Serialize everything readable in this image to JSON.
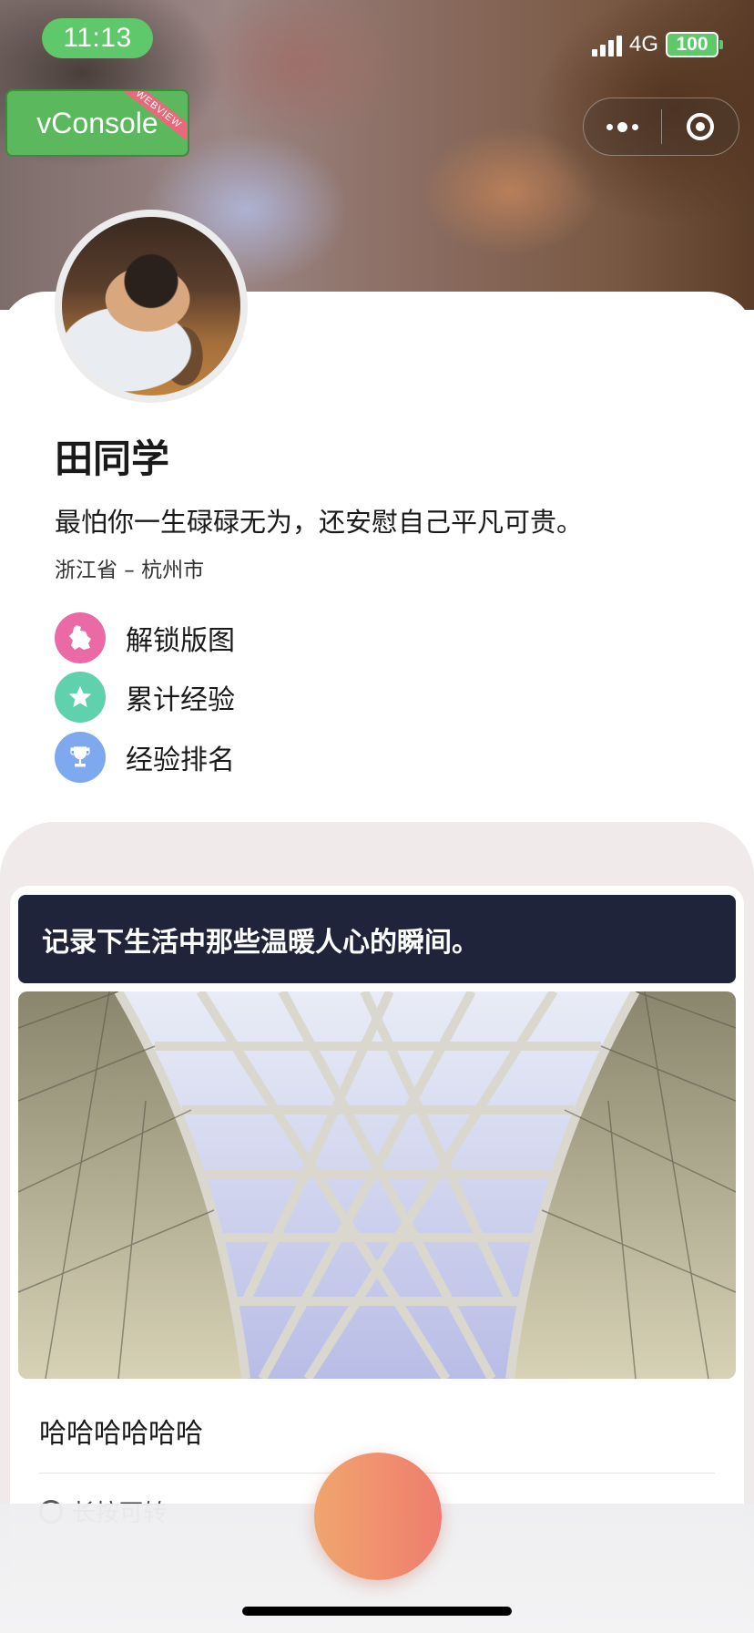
{
  "status_bar": {
    "time": "11:13",
    "network": "4G",
    "battery": "100"
  },
  "vconsole": {
    "label": "vConsole",
    "ribbon": "WEBVIEW"
  },
  "profile": {
    "name": "田同学",
    "motto": "最怕你一生碌碌无为，还安慰自己平凡可贵。",
    "location": "浙江省 – 杭州市",
    "menu": [
      {
        "label": "解锁版图",
        "icon": "map-icon",
        "color": "#ea6aa6"
      },
      {
        "label": "累计经验",
        "icon": "star-icon",
        "color": "#5fd1ac"
      },
      {
        "label": "经验排名",
        "icon": "trophy-icon",
        "color": "#7fa9ef"
      }
    ]
  },
  "post": {
    "banner": "记录下生活中那些温暖人心的瞬间。",
    "text": "哈哈哈哈哈哈",
    "meta": "长按可转"
  },
  "colors": {
    "accent_green": "#5ec86a",
    "banner_bg": "#20243a",
    "feed_bg": "#f1eaea",
    "fab_start": "#f0a56e",
    "fab_end": "#ef7d6e"
  }
}
